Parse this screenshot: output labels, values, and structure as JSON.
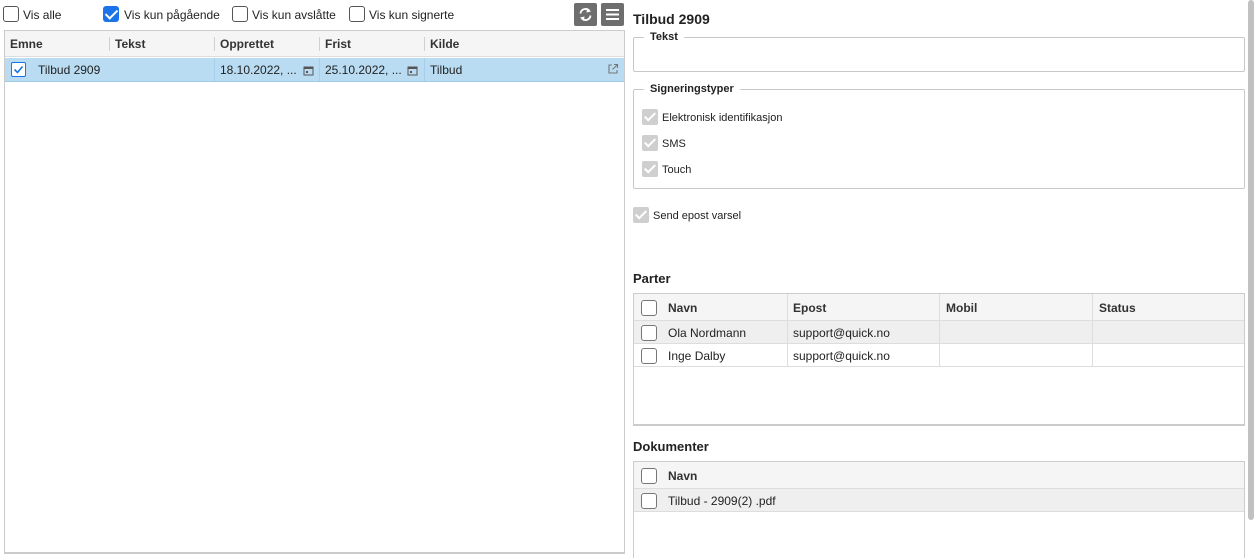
{
  "filters": {
    "vis_alle": "Vis alle",
    "vis_pagaende": "Vis kun pågående",
    "vis_avslatte": "Vis kun avslåtte",
    "vis_signerte": "Vis kun signerte"
  },
  "list": {
    "columns": [
      "Emne",
      "Tekst",
      "Opprettet",
      "Frist",
      "Kilde"
    ],
    "rows": [
      {
        "emne": "Tilbud 2909",
        "tekst": "",
        "opprettet": "18.10.2022, ...",
        "frist": "25.10.2022, ...",
        "kilde": "Tilbud"
      }
    ]
  },
  "detail": {
    "title": "Tilbud 2909",
    "tekst_legend": "Tekst",
    "sign_legend": "Signeringstyper",
    "sign_types": [
      "Elektronisk identifikasjon",
      "SMS",
      "Touch"
    ],
    "send_epost": "Send epost varsel",
    "parter_title": "Parter",
    "parter_columns": [
      "Navn",
      "Epost",
      "Mobil",
      "Status"
    ],
    "parter_rows": [
      {
        "navn": "Ola Nordmann",
        "epost": "support@quick.no",
        "mobil": "",
        "status": ""
      },
      {
        "navn": "Inge Dalby",
        "epost": "support@quick.no",
        "mobil": "",
        "status": ""
      }
    ],
    "dok_title": "Dokumenter",
    "dok_columns": [
      "Navn"
    ],
    "dok_rows": [
      {
        "navn": "Tilbud - 2909(2) .pdf"
      }
    ]
  },
  "icons": {
    "refresh": "refresh-icon",
    "menu": "menu-icon",
    "calendar": "calendar-icon",
    "external": "external-link-icon"
  },
  "colors": {
    "selected_row": "#b9dcf3",
    "checkbox_blue": "#1a73e8",
    "icon_button": "#6e6e6e"
  }
}
